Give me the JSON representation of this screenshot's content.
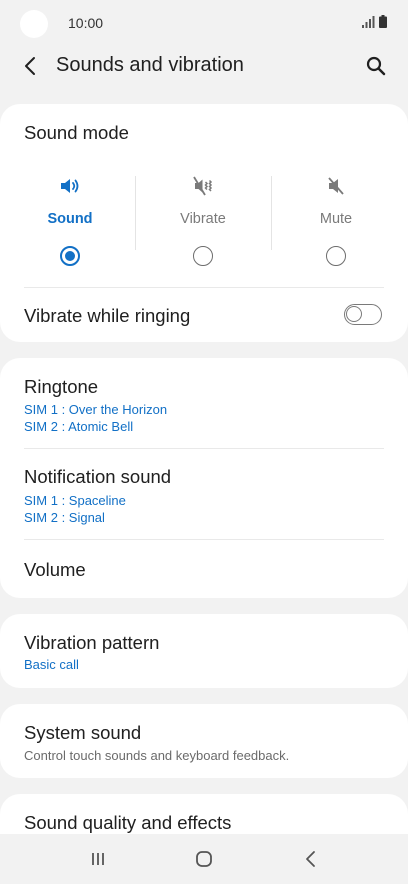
{
  "status_bar": {
    "time": "10:00"
  },
  "app_bar": {
    "title": "Sounds and vibration"
  },
  "sound_mode": {
    "title": "Sound mode",
    "options": [
      {
        "label": "Sound",
        "icon": "speaker-icon",
        "selected": true
      },
      {
        "label": "Vibrate",
        "icon": "vibrate-icon",
        "selected": false
      },
      {
        "label": "Mute",
        "icon": "mute-icon",
        "selected": false
      }
    ],
    "vibrate_while_ringing": {
      "label": "Vibrate while ringing",
      "enabled": false
    }
  },
  "ringtone": {
    "title": "Ringtone",
    "sim1": "SIM 1 : Over the Horizon",
    "sim2": "SIM 2 : Atomic Bell"
  },
  "notification_sound": {
    "title": "Notification sound",
    "sim1": "SIM 1 : Spaceline",
    "sim2": "SIM 2 : Signal"
  },
  "volume": {
    "title": "Volume"
  },
  "vibration_pattern": {
    "title": "Vibration pattern",
    "value": "Basic call"
  },
  "system_sound": {
    "title": "System sound",
    "description": "Control touch sounds and keyboard feedback."
  },
  "sound_quality": {
    "title": "Sound quality and effects"
  },
  "colors": {
    "accent": "#1270c6",
    "background": "#f2f2f2",
    "card": "#ffffff"
  }
}
